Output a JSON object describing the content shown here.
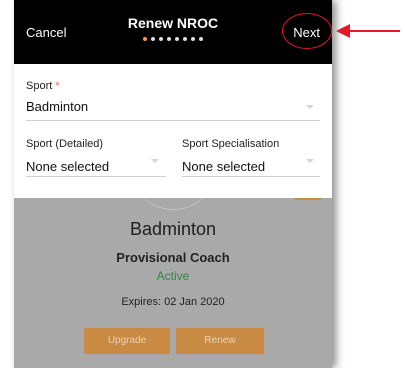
{
  "header": {
    "cancel_label": "Cancel",
    "title": "Renew NROC",
    "next_label": "Next",
    "steps_total": 8,
    "step_current": 1
  },
  "form": {
    "sport_label": "Sport",
    "required_mark": "*",
    "sport_value": "Badminton",
    "sport_detailed_label": "Sport (Detailed)",
    "sport_detailed_value": "None selected",
    "sport_specialisation_label": "Sport Specialisation",
    "sport_specialisation_value": "None selected"
  },
  "card": {
    "sport": "Badminton",
    "level": "Provisional Coach",
    "status": "Active",
    "expires": "Expires: 02 Jan 2020",
    "upgrade_label": "Upgrade",
    "renew_label": "Renew"
  },
  "colors": {
    "header_bg": "#000000",
    "accent_orange": "#c98a44",
    "status_green": "#2e8b3c",
    "annotation_red": "#e8142a"
  }
}
